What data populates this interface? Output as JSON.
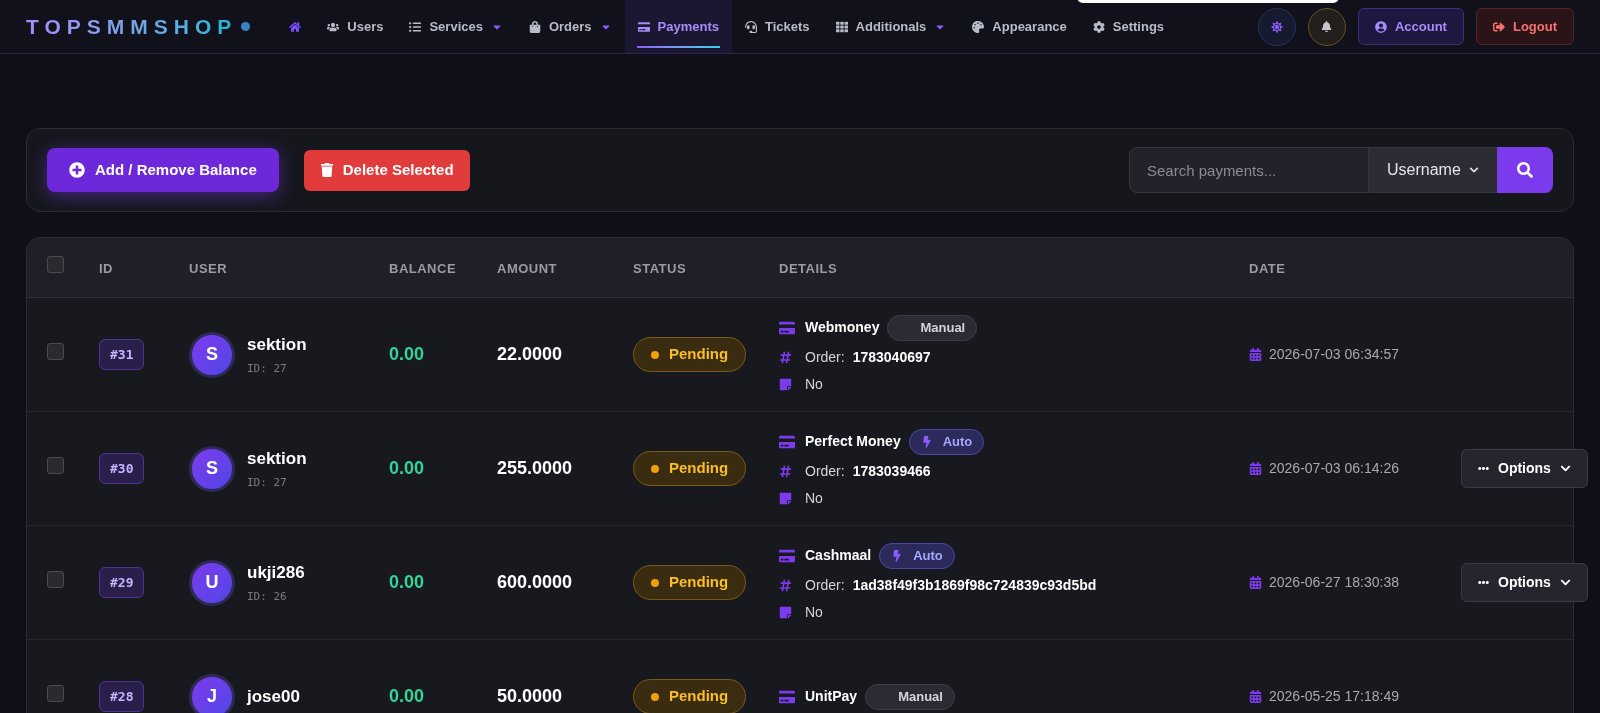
{
  "brand": {
    "text": "TOPSMMSHOP"
  },
  "nav": [
    {
      "selected": false,
      "dropdown": false
    },
    {
      "label": "Users",
      "selected": false,
      "dropdown": false
    },
    {
      "label": "Services",
      "selected": false,
      "dropdown": true
    },
    {
      "label": "Orders",
      "selected": false,
      "dropdown": true
    },
    {
      "label": "Payments",
      "selected": true,
      "dropdown": false
    },
    {
      "label": "Tickets",
      "selected": false,
      "dropdown": false
    },
    {
      "label": "Additionals",
      "selected": false,
      "dropdown": true
    },
    {
      "label": "Appearance",
      "selected": false,
      "dropdown": false
    },
    {
      "label": "Settings",
      "selected": false,
      "dropdown": false
    }
  ],
  "header_actions": {
    "account": "Account",
    "logout": "Logout"
  },
  "toolbar": {
    "add_button": "Add / Remove Balance",
    "delete_button": "Delete Selected",
    "search": {
      "placeholder": "Search payments..."
    },
    "filter": {
      "value": "Username"
    }
  },
  "table": {
    "select_all": {
      "checked": false
    },
    "columns": [
      "ID",
      "USER",
      "BALANCE",
      "AMOUNT",
      "STATUS",
      "DETAILS",
      "DATE"
    ],
    "rows": [
      {
        "checked": false,
        "id": "#31",
        "avatar": "S",
        "user": "sektion",
        "user_id": "ID: 27",
        "balance": "0.00",
        "amount": "22.0000",
        "status": {
          "kind": "pending",
          "label": "Pending"
        },
        "method": "Webmoney",
        "mode": {
          "kind": "manual",
          "label": "Manual"
        },
        "order_label": "Order:",
        "order": "1783040697",
        "note": "No",
        "date": "2026-07-03 06:34:57"
      },
      {
        "checked": false,
        "id": "#30",
        "avatar": "S",
        "user": "sektion",
        "user_id": "ID: 27",
        "balance": "0.00",
        "amount": "255.0000",
        "status": {
          "kind": "pending",
          "label": "Pending"
        },
        "method": "Perfect Money",
        "mode": {
          "kind": "auto",
          "label": "Auto"
        },
        "order_label": "Order:",
        "order": "1783039466",
        "note": "No",
        "date": "2026-07-03 06:14:26",
        "options": "Options"
      },
      {
        "checked": false,
        "id": "#29",
        "avatar": "U",
        "user": "ukji286",
        "user_id": "ID: 26",
        "balance": "0.00",
        "amount": "600.0000",
        "status": {
          "kind": "pending",
          "label": "Pending"
        },
        "method": "Cashmaal",
        "mode": {
          "kind": "auto",
          "label": "Auto"
        },
        "order_label": "Order:",
        "order": "1ad38f49f3b1869f98c724839c93d5bd",
        "note": "No",
        "date": "2026-06-27 18:30:38",
        "options": "Options"
      },
      {
        "checked": false,
        "id": "#28",
        "avatar": "J",
        "user": "jose00",
        "balance": "0.00",
        "amount": "50.0000",
        "status": {
          "kind": "pending",
          "label": "Pending"
        },
        "method": "UnitPay",
        "mode": {
          "kind": "manual",
          "label": "Manual"
        },
        "date": "2026-05-25 17:18:49"
      }
    ]
  }
}
